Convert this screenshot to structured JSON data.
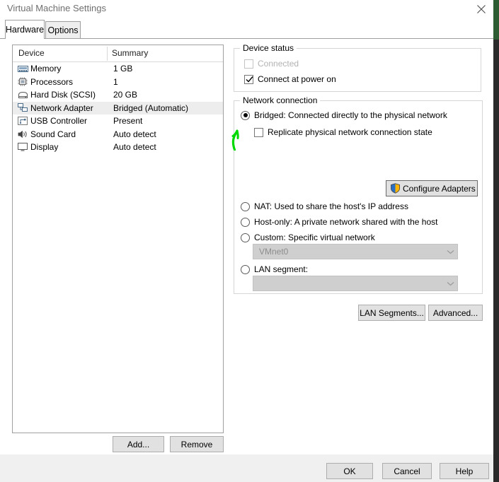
{
  "window": {
    "title": "Virtual Machine Settings",
    "close_icon": "close-icon"
  },
  "tabs": [
    {
      "label": "Hardware",
      "active": true
    },
    {
      "label": "Options",
      "active": false
    }
  ],
  "device_list": {
    "columns": [
      "Device",
      "Summary"
    ],
    "rows": [
      {
        "icon": "memory-icon",
        "device": "Memory",
        "summary": "1 GB",
        "selected": false
      },
      {
        "icon": "processor-icon",
        "device": "Processors",
        "summary": "1",
        "selected": false
      },
      {
        "icon": "hard-disk-icon",
        "device": "Hard Disk (SCSI)",
        "summary": "20 GB",
        "selected": false
      },
      {
        "icon": "network-adapter-icon",
        "device": "Network Adapter",
        "summary": "Bridged (Automatic)",
        "selected": true
      },
      {
        "icon": "usb-controller-icon",
        "device": "USB Controller",
        "summary": "Present",
        "selected": false
      },
      {
        "icon": "sound-card-icon",
        "device": "Sound Card",
        "summary": "Auto detect",
        "selected": false
      },
      {
        "icon": "display-icon",
        "device": "Display",
        "summary": "Auto detect",
        "selected": false
      }
    ],
    "add_label": "Add...",
    "remove_label": "Remove"
  },
  "device_status": {
    "group_title": "Device status",
    "connected": {
      "label": "Connected",
      "checked": false,
      "enabled": false
    },
    "connect_at_power_on": {
      "label": "Connect at power on",
      "checked": true,
      "enabled": true
    }
  },
  "network_connection": {
    "group_title": "Network connection",
    "options": [
      {
        "label": "Bridged: Connected directly to the physical network",
        "selected": true
      },
      {
        "label": "NAT: Used to share the host's IP address",
        "selected": false
      },
      {
        "label": "Host-only: A private network shared with the host",
        "selected": false
      },
      {
        "label": "Custom: Specific virtual network",
        "selected": false
      },
      {
        "label": "LAN segment:",
        "selected": false
      }
    ],
    "replicate": {
      "label": "Replicate physical network connection state",
      "checked": false
    },
    "configure_adapters": {
      "label": "Configure Adapters",
      "icon": "uac-shield-icon"
    },
    "custom_network_value": "VMnet0",
    "lan_segment_value": "",
    "lan_segments_button": "LAN Segments...",
    "advanced_button": "Advanced..."
  },
  "footer": {
    "ok": "OK",
    "cancel": "Cancel",
    "help": "Help"
  },
  "annotation": {
    "type": "hand-drawn-arrow",
    "points_to": "Bridged: Connected directly to the physical network",
    "color": "#00d900"
  },
  "colors": {
    "dialog_bg": "#ffffff",
    "footer_bg": "#f0f0f0",
    "button_face": "#e1e1e1",
    "selection": "#ededed",
    "disabled_text": "#b3b3b3",
    "combo_disabled_bg": "#cfcfcf",
    "group_border": "#d6d6d6",
    "annotation_green": "#00d900",
    "desktop_green": "#2f5d33",
    "desktop_dark": "#2a2a2a"
  }
}
